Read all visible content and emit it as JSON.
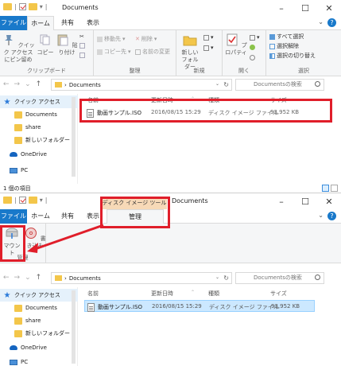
{
  "window1": {
    "title": "Documents",
    "tabs": {
      "file": "ファイル",
      "home": "ホーム",
      "share": "共有",
      "view": "表示"
    },
    "ribbon": {
      "quick_access_label": "クイック アクセス\nにピン留め",
      "copy": "コピー",
      "paste": "貼り付け",
      "clipboard_group": "クリップボード",
      "move_to": "移動先",
      "copy_to": "コピー先",
      "delete": "削除",
      "rename": "名前の変更",
      "organize_group": "整理",
      "new_folder": "新しい\nフォルダー",
      "new_group": "新規",
      "properties": "プロパティ",
      "open_group": "開く",
      "select_all": "すべて選択",
      "select_none": "選択解除",
      "invert_selection": "選択の切り替え",
      "select_group": "選択"
    },
    "address": "Documents",
    "search_placeholder": "Documentsの検索",
    "nav": [
      {
        "label": "クイック アクセス",
        "icon": "star-icon"
      },
      {
        "label": "Documents",
        "icon": "folder-icon"
      },
      {
        "label": "share",
        "icon": "share-folder-icon"
      },
      {
        "label": "新しいフォルダー",
        "icon": "folder-icon"
      },
      {
        "label": "OneDrive",
        "icon": "cloud-icon"
      },
      {
        "label": "PC",
        "icon": "pc-icon"
      }
    ],
    "columns": {
      "name": "名前",
      "modified": "更新日時",
      "type": "種類",
      "size": "サイズ"
    },
    "file": {
      "name": "動画サンプル.ISO",
      "modified": "2016/08/15 15:29",
      "type": "ディスク イメージ ファイル",
      "size": "93,952 KB"
    },
    "status": "1 個の項目"
  },
  "window2": {
    "title": "Documents",
    "tools_header": "ディスク イメージ ツール",
    "tabs": {
      "file": "ファイル",
      "home": "ホーム",
      "share": "共有",
      "view": "表示",
      "manage": "管理"
    },
    "ribbon": {
      "mount": "マウント",
      "burn": "書き込み",
      "group": "管理"
    },
    "address": "Documents",
    "search_placeholder": "Documentsの検索",
    "nav": [
      {
        "label": "クイック アクセス",
        "icon": "star-icon"
      },
      {
        "label": "Documents",
        "icon": "folder-icon"
      },
      {
        "label": "share",
        "icon": "share-folder-icon"
      },
      {
        "label": "新しいフォルダー",
        "icon": "folder-icon"
      },
      {
        "label": "OneDrive",
        "icon": "cloud-icon"
      },
      {
        "label": "PC",
        "icon": "pc-icon"
      }
    ],
    "columns": {
      "name": "名前",
      "modified": "更新日時",
      "type": "種類",
      "size": "サイズ"
    },
    "file": {
      "name": "動画サンプル.ISO",
      "modified": "2016/08/15 15:29",
      "type": "ディスク イメージ ファイル",
      "size": "93,952 KB"
    }
  },
  "colors": {
    "accent": "#1979ca",
    "highlight": "#e01e2a",
    "tools_tab": "#f7d9b7",
    "selection": "#cce8ff"
  }
}
